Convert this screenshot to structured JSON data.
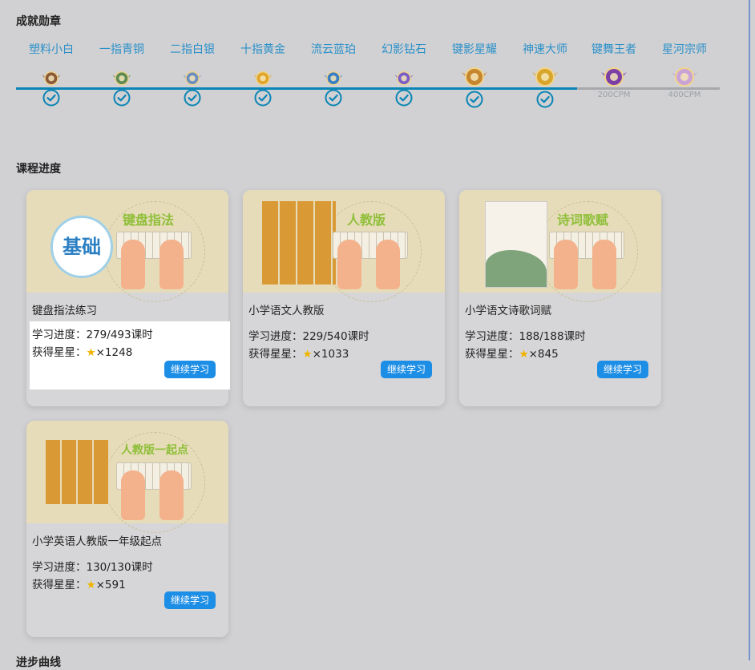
{
  "achievements": {
    "title": "成就勋章",
    "badges": [
      {
        "name": "塑料小白",
        "achieved": true,
        "requirement": "",
        "color": "#8a5a3a"
      },
      {
        "name": "一指青铜",
        "achieved": true,
        "requirement": "",
        "color": "#5e8a55"
      },
      {
        "name": "二指白银",
        "achieved": true,
        "requirement": "",
        "color": "#6b8fc0"
      },
      {
        "name": "十指黄金",
        "achieved": true,
        "requirement": "",
        "color": "#e0a52a"
      },
      {
        "name": "流云蓝珀",
        "achieved": true,
        "requirement": "",
        "color": "#3a7ec4"
      },
      {
        "name": "幻影钻石",
        "achieved": true,
        "requirement": "",
        "color": "#7a5ec8"
      },
      {
        "name": "键影星耀",
        "achieved": true,
        "requirement": "",
        "color": "#c5862e"
      },
      {
        "name": "神速大师",
        "achieved": true,
        "requirement": "",
        "color": "#d9a62c"
      },
      {
        "name": "键舞王者",
        "achieved": false,
        "requirement": "200CPM",
        "color": "#7b3fa6"
      },
      {
        "name": "星河宗师",
        "achieved": false,
        "requirement": "400CPM",
        "color": "#c9a3d6"
      }
    ]
  },
  "course_progress": {
    "title": "课程进度",
    "cards": [
      {
        "banner_label": "键盘指法",
        "banner_badge": "基础",
        "title": "键盘指法练习",
        "progress": "学习进度：279/493课时",
        "stars": "×1248",
        "star_icon": "★",
        "button": "继续学习"
      },
      {
        "banner_label": "人教版",
        "title": "小学语文人教版",
        "progress": "学习进度：229/540课时",
        "stars": "×1033",
        "star_icon": "★",
        "button": "继续学习"
      },
      {
        "banner_label": "诗词歌赋",
        "title": "小学语文诗歌词赋",
        "progress": "学习进度：188/188课时",
        "stars": "×845",
        "star_icon": "★",
        "button": "继续学习"
      },
      {
        "banner_label": "人教版一起点",
        "title": "小学英语人教版一年级起点",
        "progress": "学习进度：130/130课时",
        "stars": "×591",
        "star_icon": "★",
        "button": "继续学习"
      }
    ],
    "stars_label": "获得星星："
  },
  "next_section_title": "进步曲线",
  "colors": {
    "accent": "#1d8ee6",
    "badge_text": "#2a90c9",
    "check": "#0a85b5",
    "star": "#f0b400"
  }
}
